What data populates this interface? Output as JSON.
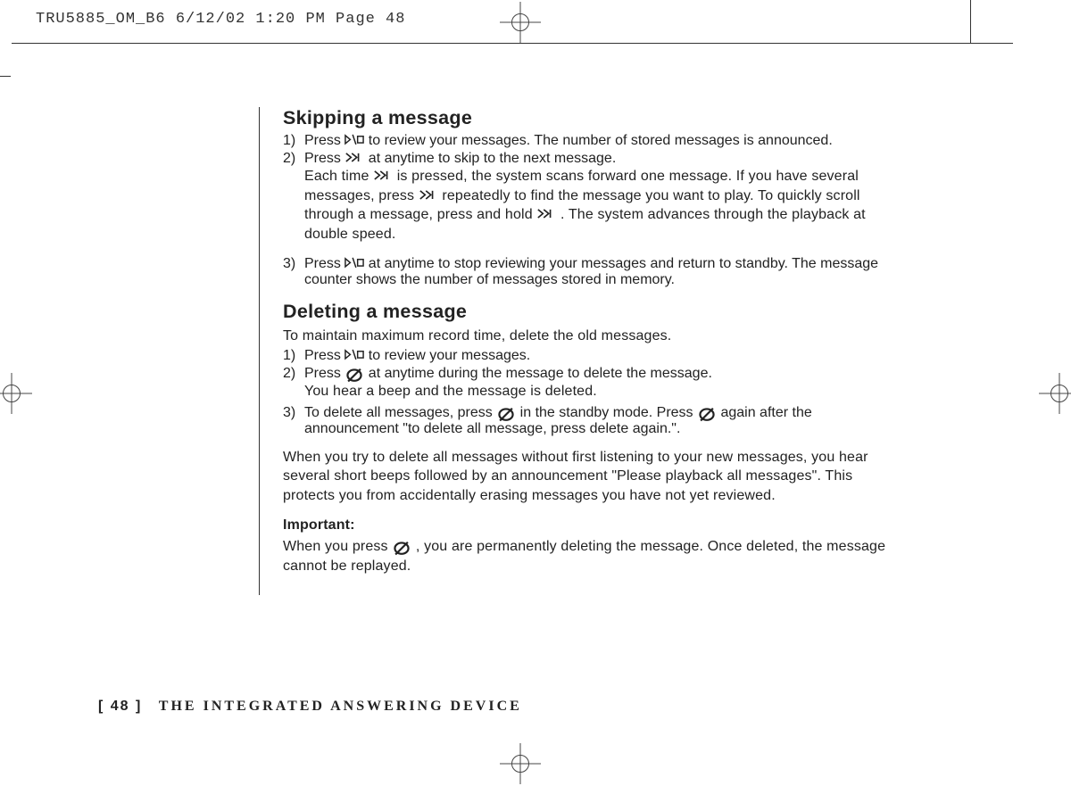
{
  "crop_header": "TRU5885_OM_B6  6/12/02  1:20 PM  Page 48",
  "skipping": {
    "heading": "Skipping a message",
    "step1_pre": "Press ",
    "step1_post": " to review your messages. The number of stored messages is announced.",
    "step2_line1_pre": "Press ",
    "step2_line1_post": " at anytime to skip to the next message.",
    "step2_line2_pre": "Each time ",
    "step2_line2_mid": " is pressed, the system scans forward one message. If you have several messages, press ",
    "step2_line2_mid2": " repeatedly to find the message you want to play. To quickly scroll through a message, press and hold ",
    "step2_line2_post": ". The system advances through the playback at double speed.",
    "step3_pre": "Press ",
    "step3_post": " at anytime to stop reviewing your messages and return to standby. The message counter shows the number of messages stored in memory."
  },
  "deleting": {
    "heading": "Deleting a message",
    "intro": "To maintain maximum record time, delete the old messages.",
    "step1_pre": "Press ",
    "step1_post": " to review your messages.",
    "step2_line1_pre": "Press ",
    "step2_line1_post": " at anytime during the message to delete the message.",
    "step2_line2": "You hear a beep and the message is deleted.",
    "step3_pre": "To delete all messages, press ",
    "step3_mid": " in the standby mode. Press ",
    "step3_post": " again after the announcement \"to delete all message, press delete again.\".",
    "warn": "When you try to delete all messages without first listening to your new messages, you hear several short beeps followed by an announcement \"Please playback all messages\". This protects you from accidentally erasing messages you have not yet reviewed.",
    "important_label": "Important:",
    "important_pre": "When you press ",
    "important_post": ", you are permanently deleting the message. Once deleted, the message cannot be replayed."
  },
  "nums": {
    "n1": "1)",
    "n2": "2)",
    "n3": "3)"
  },
  "footer": {
    "page_label": "[ 48 ]",
    "section": "THE INTEGRATED ANSWERING DEVICE"
  }
}
